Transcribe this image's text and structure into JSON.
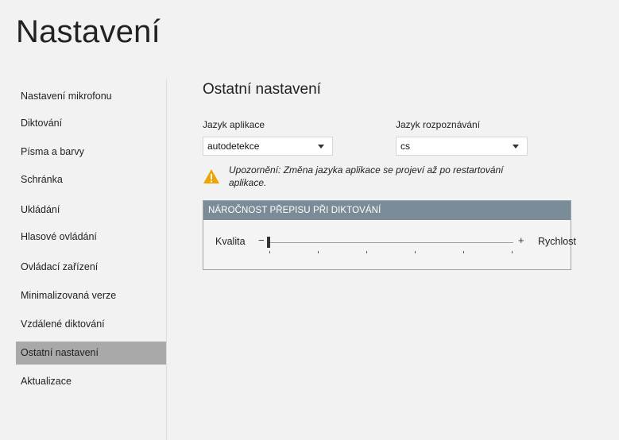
{
  "page_title": "Nastavení",
  "sidebar": {
    "items": [
      {
        "label": "Nastavení mikrofonu"
      },
      {
        "label": "Diktování"
      },
      {
        "label": "Písma a barvy"
      },
      {
        "label": "Schránka"
      },
      {
        "label": "Ukládání"
      },
      {
        "label": "Hlasové ovládání"
      },
      {
        "label": "Ovládací zařízení"
      },
      {
        "label": "Minimalizovaná verze"
      },
      {
        "label": "Vzdálené diktování"
      },
      {
        "label": "Ostatní nastavení",
        "active": true
      },
      {
        "label": "Aktualizace"
      }
    ]
  },
  "main": {
    "section_title": "Ostatní nastavení",
    "app_language": {
      "label": "Jazyk aplikace",
      "value": "autodetekce"
    },
    "recognition_language": {
      "label": "Jazyk rozpoznávání",
      "value": "cs"
    },
    "warning": {
      "icon": "warning-icon",
      "text_line1": "Upozornění: Změna jazyka aplikace se projeví až po restartování",
      "text_line2": "aplikace."
    },
    "transcription_panel": {
      "header": "NÁROČNOST PŘEPISU PŘI DIKTOVÁNÍ",
      "left_label": "Kvalita",
      "right_label": "Rychlost",
      "minus": "−",
      "plus": "+",
      "slider_value": 0,
      "slider_min": 0,
      "slider_max": 5
    }
  },
  "colors": {
    "background": "#f2f2f2",
    "sidebar_active": "#a9a9a9",
    "panel_header": "#7a8c97",
    "warning": "#f0a400"
  }
}
